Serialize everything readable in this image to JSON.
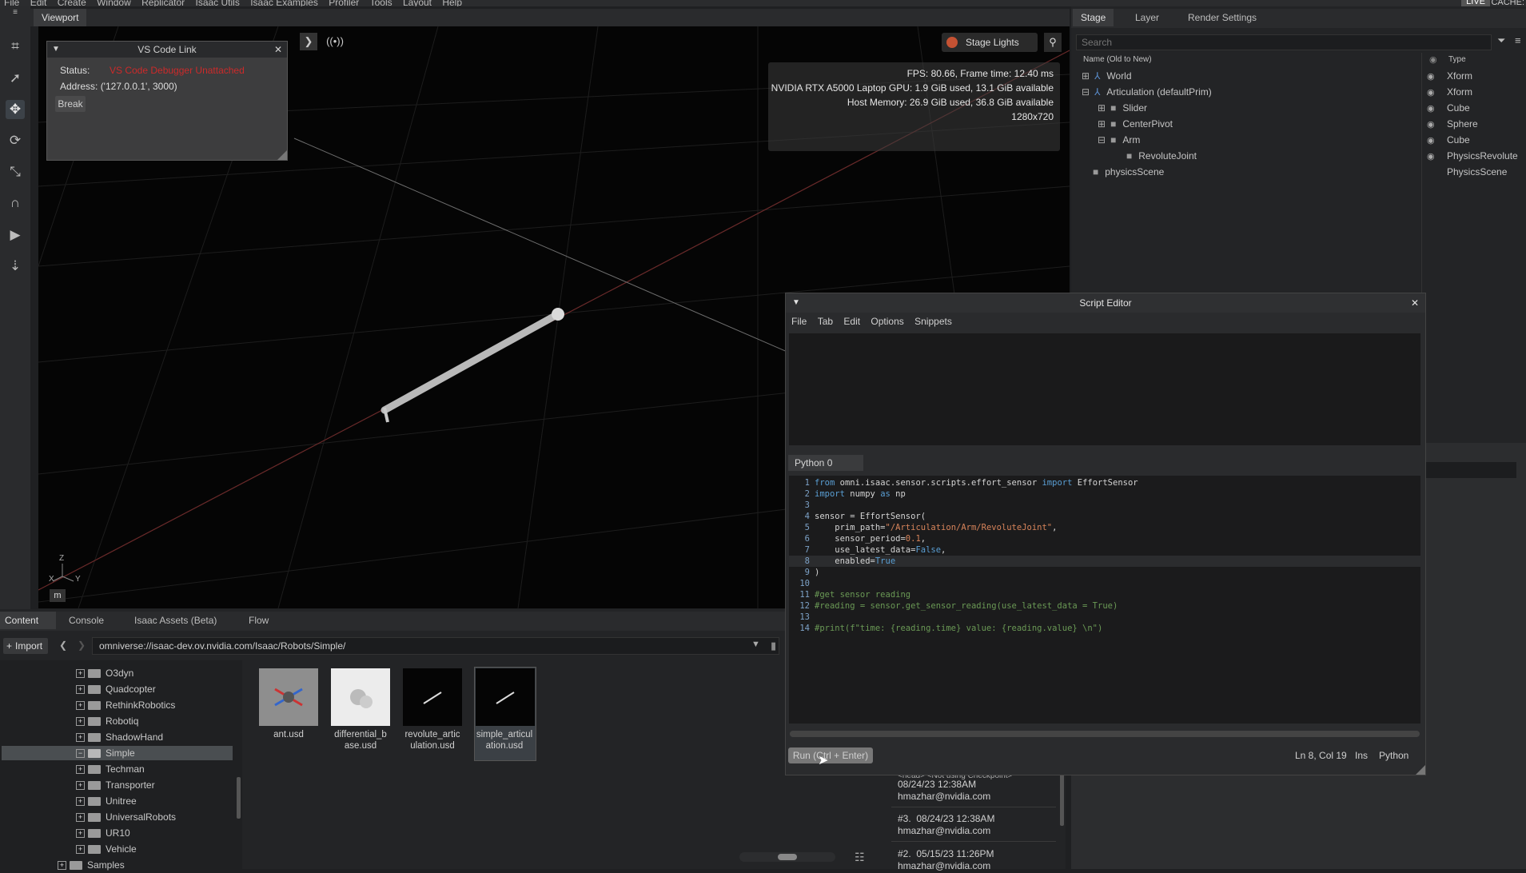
{
  "menubar": {
    "items": [
      "File",
      "Edit",
      "Create",
      "Window",
      "Replicator",
      "Isaac Utils",
      "Isaac Examples",
      "Profiler",
      "Tools",
      "Layout",
      "Help"
    ],
    "live": "LIVE",
    "cache": "CACHE:"
  },
  "viewport": {
    "tab": "Viewport",
    "stage_lights": "Stage Lights",
    "stats": [
      "FPS: 80.66, Frame time: 12.40 ms",
      "NVIDIA RTX A5000 Laptop GPU: 1.9 GiB used, 13.1 GiB available",
      "Host Memory: 26.9 GiB used, 36.8 GiB available",
      "1280x720"
    ],
    "axes": {
      "z": "Z",
      "x": "X",
      "y": "Y"
    },
    "unit": "m"
  },
  "vscode": {
    "title": "VS Code Link",
    "status_label": "Status:",
    "status_value": "VS Code Debugger Unattached",
    "address": "Address: ('127.0.0.1', 3000)",
    "break_label": "Break"
  },
  "stage": {
    "tabs": [
      "Stage",
      "Layer",
      "Render Settings"
    ],
    "search_placeholder": "Search",
    "col_name": "Name (Old to New)",
    "col_type": "Type",
    "rows": [
      {
        "name": "World",
        "type": "Xform"
      },
      {
        "name": "Articulation (defaultPrim)",
        "type": "Xform"
      },
      {
        "name": "Slider",
        "type": "Cube"
      },
      {
        "name": "CenterPivot",
        "type": "Sphere"
      },
      {
        "name": "Arm",
        "type": "Cube"
      },
      {
        "name": "RevoluteJoint",
        "type": "PhysicsRevolute"
      },
      {
        "name": "physicsScene",
        "type": "PhysicsScene"
      }
    ]
  },
  "script_editor": {
    "title": "Script Editor",
    "menu": [
      "File",
      "Tab",
      "Edit",
      "Options",
      "Snippets"
    ],
    "tab": "Python 0",
    "code": [
      "from omni.isaac.sensor.scripts.effort_sensor import EffortSensor",
      "import numpy as np",
      "",
      "sensor = EffortSensor(",
      "    prim_path=\"/Articulation/Arm/RevoluteJoint\",",
      "    sensor_period=0.1,",
      "    use_latest_data=False,",
      "    enabled=True",
      ")",
      "",
      "#get sensor reading",
      "#reading = sensor.get_sensor_reading(use_latest_data = True)",
      "",
      "#print(f\"time: {reading.time} value: {reading.value} \\n\")"
    ],
    "run_label": "Run (Ctrl + Enter)",
    "cursor": "Ln 8, Col 19",
    "mode": "Ins",
    "language": "Python"
  },
  "content": {
    "tabs": [
      "Content",
      "Console",
      "Isaac Assets (Beta)",
      "Flow"
    ],
    "import_label": "Import",
    "path": "omniverse://isaac-dev.ov.nvidia.com/Isaac/Robots/Simple/",
    "folders": [
      "O3dyn",
      "Quadcopter",
      "RethinkRobotics",
      "Robotiq",
      "ShadowHand",
      "Simple",
      "Techman",
      "Transporter",
      "Unitree",
      "UniversalRobots",
      "UR10",
      "Vehicle"
    ],
    "parent_folder": "Samples",
    "files": [
      {
        "line1": "ant.usd",
        "line2": ""
      },
      {
        "line1": "differential_b",
        "line2": "ase.usd"
      },
      {
        "line1": "revolute_artic",
        "line2": "ulation.usd"
      },
      {
        "line1": "simple_articul",
        "line2": "ation.usd"
      }
    ]
  },
  "checkpoints": [
    {
      "head": "<head> <Not using Checkpoint>",
      "date": "08/24/23 12:38AM",
      "user": "hmazhar@nvidia.com"
    },
    {
      "head": "#3.",
      "date": "08/24/23 12:38AM",
      "user": "hmazhar@nvidia.com"
    },
    {
      "head": "#2.",
      "date": "05/15/23 11:26PM",
      "user": "hmazhar@nvidia.com"
    }
  ]
}
